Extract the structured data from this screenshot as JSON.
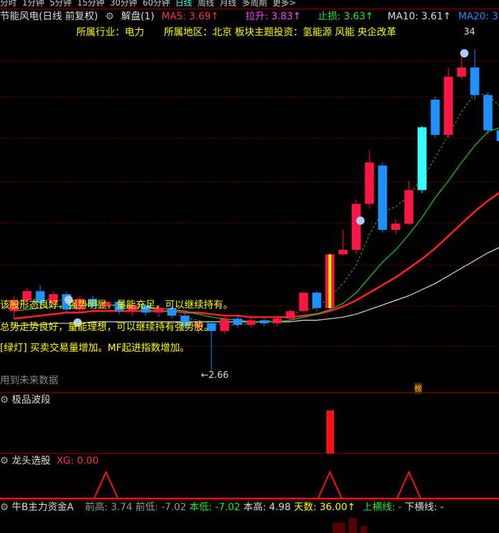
{
  "topbar": {
    "items": [
      "分时",
      "1分钟",
      "5分钟",
      "15分钟",
      "30分钟",
      "60分钟",
      "日线",
      "周线",
      "月线",
      "多周期",
      "更多>"
    ],
    "active_index": 6
  },
  "header": {
    "title": "节能风电(日线 前复权)",
    "jiepan": "解盘(1)",
    "ma5": "MA5: 3.69↑",
    "lasheng": "拉升: 3.83↑",
    "zhisun": "止损: 3.63↑",
    "ma10": "MA10: 3.61↑",
    "ma20": "MA20: 3"
  },
  "info": {
    "industry": "所属行业：电力",
    "region": "所属地区：北京",
    "theme": "板块主题投资：氢能源 风能 央企改革"
  },
  "annotations": {
    "line1": "该股形态良好，强势明显，量能充足，可以继续持有。",
    "line2": "总势走势良好，量能理想，可以继续持有强势股。",
    "line3": "[绿灯] 买卖交易量增加。MF起进指数增加。",
    "future_note": "用到未来数据",
    "high_label": "34",
    "low_label": "←2.66",
    "bang": "榜"
  },
  "panels": {
    "jipin": {
      "title": "极品波段"
    },
    "longtou": {
      "title": "龙头选股",
      "xg": "XG: 0.00"
    },
    "zhuli": {
      "title": "牛B主力资金A",
      "qiangao": "前高: 3.74",
      "qiandi": "前低: -7.02",
      "bendi": "本低: -7.02",
      "bengao": "本高: 4.98",
      "tianshu": "天数: 36.00↑",
      "shanghengxian": "上横线: -",
      "xiahengxian": "下横线: -"
    }
  },
  "colors": {
    "up": "#ff1744",
    "down": "#1e90ff",
    "cyan": "#33ffff",
    "yellow": "#ffff00",
    "green": "#22cc22",
    "white": "#dddddd",
    "grid": "#8b0000"
  },
  "chart_data": {
    "type": "candlestick",
    "candles": [
      {
        "o": 3.05,
        "c": 3.12,
        "h": 3.15,
        "l": 3.0
      },
      {
        "o": 3.12,
        "c": 3.18,
        "h": 3.2,
        "l": 3.08
      },
      {
        "o": 3.18,
        "c": 3.1,
        "h": 3.22,
        "l": 3.06
      },
      {
        "o": 3.1,
        "c": 3.16,
        "h": 3.18,
        "l": 3.08
      },
      {
        "o": 3.16,
        "c": 3.06,
        "h": 3.18,
        "l": 3.04
      },
      {
        "o": 3.06,
        "c": 3.13,
        "h": 3.15,
        "l": 3.04
      },
      {
        "o": 3.13,
        "c": 3.08,
        "h": 3.15,
        "l": 3.06
      },
      {
        "o": 3.08,
        "c": 3.11,
        "h": 3.12,
        "l": 3.05
      },
      {
        "o": 3.11,
        "c": 3.05,
        "h": 3.12,
        "l": 3.03
      },
      {
        "o": 3.05,
        "c": 3.09,
        "h": 3.1,
        "l": 3.02
      },
      {
        "o": 3.09,
        "c": 3.04,
        "h": 3.1,
        "l": 3.02
      },
      {
        "o": 3.04,
        "c": 3.07,
        "h": 3.09,
        "l": 3.01
      },
      {
        "o": 3.07,
        "c": 3.02,
        "h": 3.08,
        "l": 3.0
      },
      {
        "o": 3.02,
        "c": 2.95,
        "h": 3.04,
        "l": 2.93
      },
      {
        "o": 2.95,
        "c": 2.97,
        "h": 2.99,
        "l": 2.9
      },
      {
        "o": 2.97,
        "c": 2.92,
        "h": 2.98,
        "l": 2.66
      },
      {
        "o": 2.92,
        "c": 3.0,
        "h": 3.02,
        "l": 2.9
      },
      {
        "o": 3.0,
        "c": 2.96,
        "h": 3.02,
        "l": 2.94
      },
      {
        "o": 2.96,
        "c": 2.99,
        "h": 3.01,
        "l": 2.94
      },
      {
        "o": 2.99,
        "c": 2.97,
        "h": 3.0,
        "l": 2.95
      },
      {
        "o": 2.97,
        "c": 3.0,
        "h": 3.02,
        "l": 2.95
      },
      {
        "o": 3.0,
        "c": 3.05,
        "h": 3.06,
        "l": 2.98
      },
      {
        "o": 3.05,
        "c": 3.17,
        "h": 3.18,
        "l": 3.04
      },
      {
        "o": 3.17,
        "c": 3.07,
        "h": 3.18,
        "l": 3.05
      },
      {
        "o": 3.07,
        "c": 3.42,
        "h": 3.43,
        "l": 3.05
      },
      {
        "o": 3.42,
        "c": 3.45,
        "h": 3.58,
        "l": 3.41
      },
      {
        "o": 3.45,
        "c": 3.75,
        "h": 3.78,
        "l": 3.42
      },
      {
        "o": 3.75,
        "c": 4.02,
        "h": 4.1,
        "l": 3.72
      },
      {
        "o": 4.0,
        "c": 3.58,
        "h": 4.02,
        "l": 3.56
      },
      {
        "o": 3.58,
        "c": 3.62,
        "h": 3.65,
        "l": 3.55
      },
      {
        "o": 3.62,
        "c": 3.84,
        "h": 3.9,
        "l": 3.61
      },
      {
        "o": 3.84,
        "c": 4.25,
        "h": 4.26,
        "l": 3.82
      },
      {
        "o": 4.43,
        "c": 4.2,
        "h": 4.45,
        "l": 4.18
      },
      {
        "o": 4.2,
        "c": 4.58,
        "h": 4.64,
        "l": 4.18
      },
      {
        "o": 4.58,
        "c": 4.64,
        "h": 4.72,
        "l": 4.56
      },
      {
        "o": 4.64,
        "c": 4.46,
        "h": 4.76,
        "l": 4.43
      },
      {
        "o": 4.46,
        "c": 4.23,
        "h": 4.48,
        "l": 4.2
      },
      {
        "o": 4.23,
        "c": 4.16,
        "h": 4.24,
        "l": 4.1
      },
      {
        "o": 4.16,
        "c": 4.2,
        "h": 4.22,
        "l": 4.14
      }
    ],
    "ma5": [
      3.1,
      3.12,
      3.13,
      3.12,
      3.12,
      3.11,
      3.1,
      3.09,
      3.08,
      3.07,
      3.06,
      3.05,
      3.04,
      3.01,
      2.99,
      2.97,
      2.96,
      2.96,
      2.97,
      2.98,
      3.0,
      3.02,
      3.06,
      3.07,
      3.14,
      3.23,
      3.35,
      3.55,
      3.7,
      3.73,
      3.8,
      3.92,
      4.05,
      4.2,
      4.35,
      4.47,
      4.46,
      4.38,
      4.3
    ],
    "ma10": [
      3.05,
      3.06,
      3.07,
      3.08,
      3.08,
      3.09,
      3.09,
      3.09,
      3.09,
      3.08,
      3.08,
      3.07,
      3.06,
      3.05,
      3.03,
      3.01,
      3.0,
      2.99,
      2.98,
      2.98,
      2.98,
      2.99,
      3.01,
      3.03,
      3.06,
      3.1,
      3.17,
      3.27,
      3.37,
      3.45,
      3.55,
      3.66,
      3.79,
      3.9,
      4.02,
      4.13,
      4.22,
      4.25,
      4.27
    ],
    "ma20": [
      3.0,
      3.01,
      3.02,
      3.03,
      3.04,
      3.04,
      3.05,
      3.05,
      3.05,
      3.05,
      3.05,
      3.05,
      3.05,
      3.04,
      3.04,
      3.03,
      3.02,
      3.02,
      3.01,
      3.01,
      3.01,
      3.01,
      3.02,
      3.03,
      3.05,
      3.08,
      3.12,
      3.17,
      3.22,
      3.27,
      3.33,
      3.39,
      3.46,
      3.54,
      3.62,
      3.7,
      3.77,
      3.83,
      3.88
    ],
    "ma60": [
      2.95,
      2.96,
      2.96,
      2.97,
      2.97,
      2.97,
      2.98,
      2.98,
      2.98,
      2.98,
      2.98,
      2.98,
      2.98,
      2.98,
      2.98,
      2.98,
      2.98,
      2.98,
      2.98,
      2.98,
      2.98,
      2.98,
      2.99,
      2.99,
      3.0,
      3.01,
      3.03,
      3.06,
      3.09,
      3.12,
      3.15,
      3.19,
      3.23,
      3.28,
      3.33,
      3.38,
      3.43,
      3.47,
      3.51
    ],
    "ylim": [
      2.55,
      4.9
    ],
    "signals_jipin": [
      24
    ],
    "signals_longtou": [
      7,
      24,
      30
    ]
  }
}
